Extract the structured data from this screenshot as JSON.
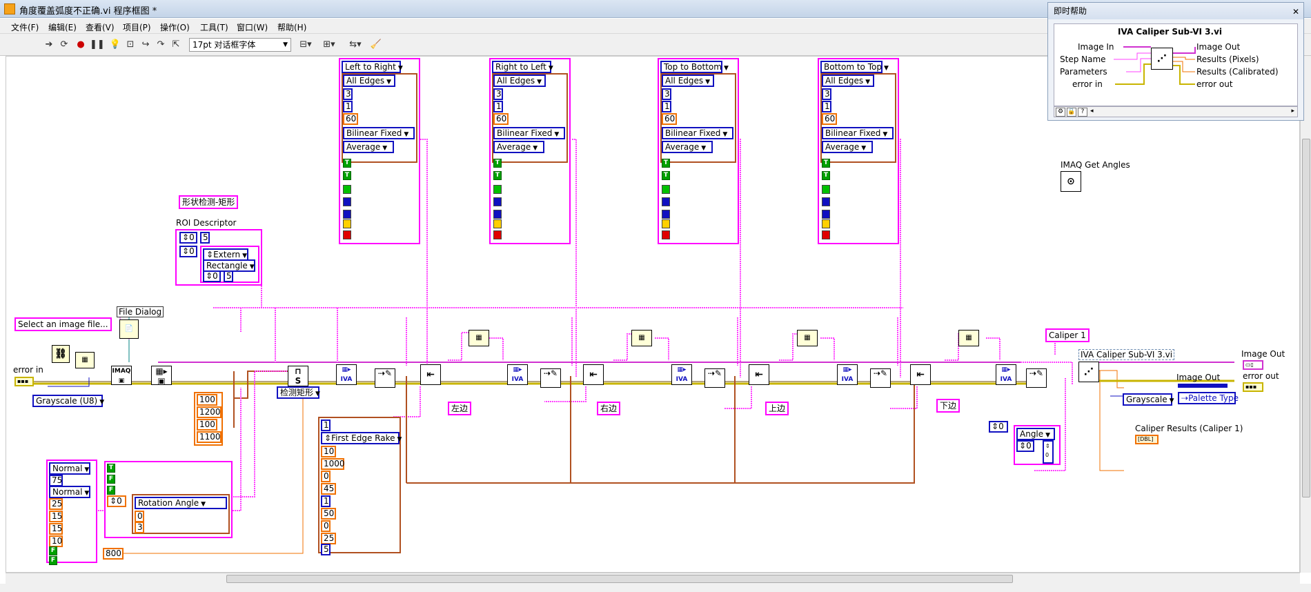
{
  "window": {
    "title": "角度覆盖弧度不正确.vi 程序框图 *"
  },
  "menu": [
    "文件(F)",
    "编辑(E)",
    "查看(V)",
    "项目(P)",
    "操作(O)",
    "工具(T)",
    "窗口(W)",
    "帮助(H)"
  ],
  "toolbar": {
    "font": "17pt 对话框字体"
  },
  "help": {
    "window_title": "即时帮助",
    "vi_name": "IVA Caliper Sub-VI 3.vi",
    "inputs": [
      "Image In",
      "Step Name",
      "Parameters",
      "error in"
    ],
    "outputs": [
      "Image Out",
      "Results (Pixels)",
      "Results (Calibrated)",
      "error out"
    ]
  },
  "directions": [
    {
      "label": "Left to Right",
      "edges": "All Edges",
      "v1": "3",
      "v2": "1",
      "v3": "60",
      "interp": "Bilinear Fixed",
      "mode": "Average"
    },
    {
      "label": "Right to Left",
      "edges": "All Edges",
      "v1": "3",
      "v2": "1",
      "v3": "60",
      "interp": "Bilinear Fixed",
      "mode": "Average"
    },
    {
      "label": "Top to Bottom",
      "edges": "All Edges",
      "v1": "3",
      "v2": "1",
      "v3": "60",
      "interp": "Bilinear Fixed",
      "mode": "Average"
    },
    {
      "label": "Bottom to Top",
      "edges": "All Edges",
      "v1": "3",
      "v2": "1",
      "v3": "60",
      "interp": "Bilinear Fixed",
      "mode": "Average"
    }
  ],
  "diagram": {
    "get_angles": "IMAQ Get Angles",
    "shape_str": "形状检测-矩形",
    "roi_label": "ROI Descriptor",
    "roi": {
      "a": "0",
      "b": "5",
      "c": "0",
      "extern": "Extern",
      "rect": "Rectangle",
      "d": "0",
      "e": "5"
    },
    "select_file": "Select an image file...",
    "file_dialog": "File Dialog",
    "error_in": "error in",
    "grayscale": "Grayscale (U8)",
    "imaq": "IMAQ",
    "rect_nums": [
      "100",
      "1200",
      "100",
      "1100"
    ],
    "detect_rect": "检测矩形",
    "left_edge": "左边",
    "right_edge": "右边",
    "top_edge": "上边",
    "bottom_edge": "下边",
    "rake": {
      "v0": "1",
      "type": "First Edge Rake",
      "vals": [
        "10",
        "1000",
        "0",
        "45",
        "1",
        "50",
        "0",
        "25",
        "5"
      ]
    },
    "normal_cluster": {
      "n1": "Normal",
      "v75": "75",
      "n2": "Normal",
      "vals": [
        "25",
        "15",
        "15",
        "10"
      ],
      "b1": "F",
      "b2": "F"
    },
    "rot_cluster": {
      "t": "T",
      "f1": "F",
      "f2": "F",
      "zero": "0",
      "label": "Rotation Angle",
      "a": "0",
      "b": "3"
    },
    "num800": "800",
    "caliper1": "Caliper 1",
    "caliper_vi": "IVA Caliper Sub-VI 3.vi",
    "angle_cluster": {
      "zero": "0",
      "label": "Angle",
      "a": "0"
    },
    "image_out": "Image Out",
    "error_out": "error out",
    "image_out2": "Image Out",
    "gray2": "Grayscale",
    "palette": "Palette Type",
    "cal_results": "Caliper Results (Caliper 1)"
  }
}
